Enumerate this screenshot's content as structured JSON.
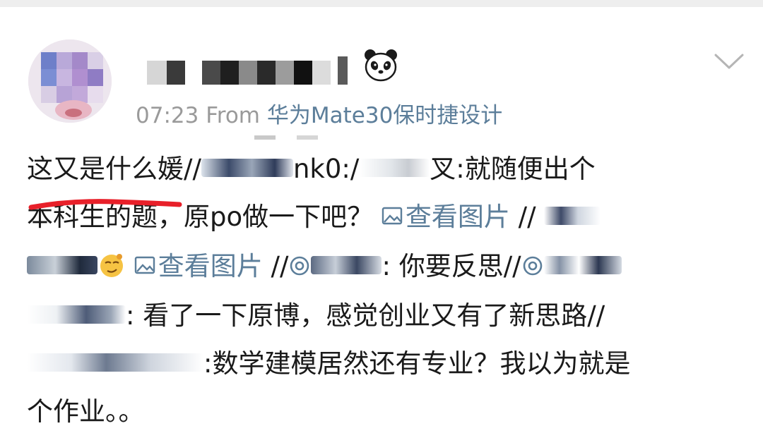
{
  "post": {
    "time": "07:23",
    "from_label": "From",
    "device": "华为Mate30保时捷设计",
    "menu_icon": "chevron-down-icon",
    "badge_icon": "panda-icon"
  },
  "text": {
    "l1_a": "这又是什么媛//",
    "l1_b": "nk0:/",
    "l1_c": "叉:就随便出个",
    "l2_a": "本科生的题，原po做一下吧？",
    "view_image": "查看图片",
    "l2_b": "//",
    "l3_a": "//",
    "l3_b": ": 你要反思//",
    "l4_a": ": 看了一下原博，感觉创业又有了新思路//",
    "l5_a": ":数学建模居然还有专业？我以为就是",
    "l6_a": "个作业。。"
  },
  "colors": {
    "link": "#5c7e9a",
    "meta": "#9a9a9a",
    "text": "#1a1a1a",
    "annotation": "#e8202a"
  }
}
